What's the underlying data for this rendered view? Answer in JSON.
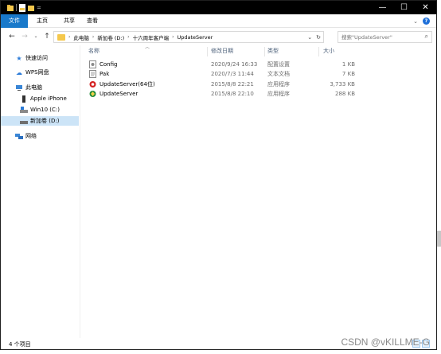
{
  "ribbon": {
    "file": "文件",
    "home": "主页",
    "share": "共享",
    "view": "查看"
  },
  "titlebar": {
    "minimize": "—",
    "maximize": "☐",
    "close": "✕",
    "qa_dropdown": "="
  },
  "address": {
    "segments": [
      "此电脑",
      "新加卷 (D:)",
      "十六周年客户端",
      "UpdateServer"
    ],
    "separator": "›"
  },
  "search": {
    "placeholder": "搜索\"UpdateServer\""
  },
  "sidebar": {
    "items": [
      {
        "label": "快速访问",
        "icon": "star-icon"
      },
      {
        "label": "WPS网盘",
        "icon": "cloud-icon"
      },
      {
        "label": "此电脑",
        "icon": "computer-icon"
      },
      {
        "label": "Apple iPhone",
        "icon": "phone-icon"
      },
      {
        "label": "Win10 (C:)",
        "icon": "drive-icon"
      },
      {
        "label": "新加卷 (D:)",
        "icon": "drive-icon"
      },
      {
        "label": "网络",
        "icon": "network-icon"
      }
    ]
  },
  "columns": {
    "name": "名称",
    "modified": "修改日期",
    "type": "类型",
    "size": "大小"
  },
  "files": [
    {
      "name": "Config",
      "modified": "2020/9/24 16:33",
      "type": "配置设置",
      "size": "1 KB",
      "icon": "config-file-icon"
    },
    {
      "name": "Pak",
      "modified": "2020/7/3 11:44",
      "type": "文本文档",
      "size": "7 KB",
      "icon": "text-file-icon"
    },
    {
      "name": "UpdateServer(64位)",
      "modified": "2015/8/8 22:21",
      "type": "应用程序",
      "size": "3,733 KB",
      "icon": "app-red-icon"
    },
    {
      "name": "UpdateServer",
      "modified": "2015/8/8 22:10",
      "type": "应用程序",
      "size": "288 KB",
      "icon": "app-green-icon"
    }
  ],
  "status": {
    "count": "4 个项目"
  },
  "watermark": "CSDN @vKILLME-G",
  "colors": {
    "accent": "#1979ca",
    "selection": "#cce4f7",
    "folder": "#f5c84c"
  }
}
